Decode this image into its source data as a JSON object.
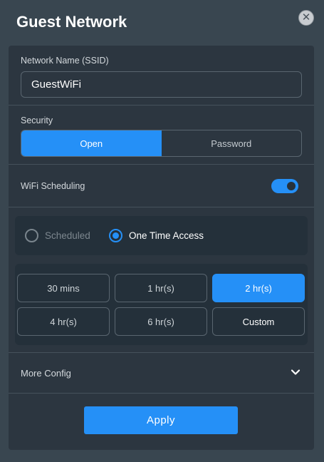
{
  "header": {
    "title": "Guest Network",
    "close_icon": "close-icon"
  },
  "ssid": {
    "label": "Network Name (SSID)",
    "value": "GuestWiFi"
  },
  "security": {
    "label": "Security",
    "options": [
      "Open",
      "Password"
    ],
    "selected": "Open"
  },
  "scheduling": {
    "label": "WiFi Scheduling",
    "enabled": true
  },
  "access_mode": {
    "options": [
      "Scheduled",
      "One Time Access"
    ],
    "selected": "One Time Access"
  },
  "durations": {
    "options": [
      "30 mins",
      "1 hr(s)",
      "2 hr(s)",
      "4 hr(s)",
      "6 hr(s)",
      "Custom"
    ],
    "selected": "2 hr(s)"
  },
  "more_config": {
    "label": "More Config",
    "icon": "chevron-down-icon"
  },
  "apply": {
    "label": "Apply"
  },
  "colors": {
    "accent": "#2590f7",
    "panel": "#2c3640",
    "background": "#394650"
  }
}
